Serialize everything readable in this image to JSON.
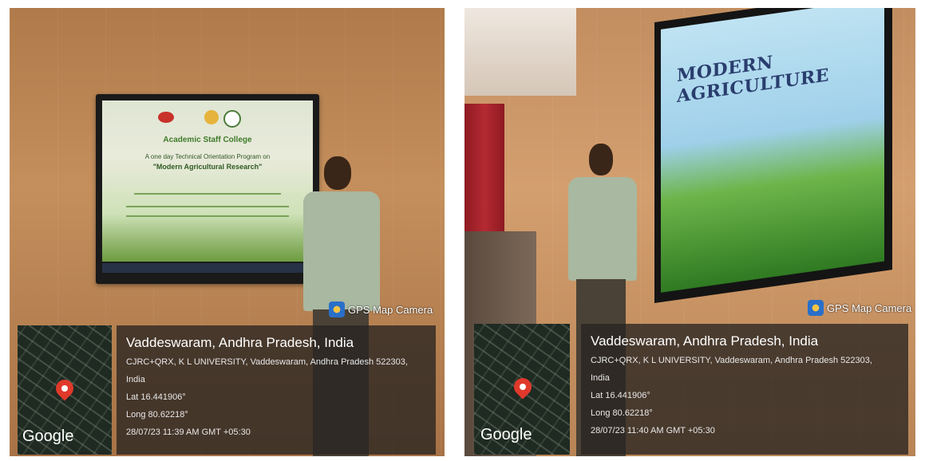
{
  "photo1": {
    "slide": {
      "line1": "Academic Staff College",
      "line2": "A one day Technical Orientation Program on",
      "line3": "\"Modern Agricultural Research\""
    },
    "gps_tag": "GPS Map Camera",
    "map_label": "Google",
    "location_title": "Vaddeswaram, Andhra Pradesh, India",
    "address_line1": "CJRC+QRX, K L UNIVERSITY, Vaddeswaram, Andhra Pradesh 522303,",
    "address_line2": "India",
    "lat": "Lat 16.441906°",
    "long": "Long 80.62218°",
    "timestamp": "28/07/23 11:39 AM GMT +05:30"
  },
  "photo2": {
    "slide_title": "MODERN AGRICULTURE",
    "gps_tag": "GPS Map Camera",
    "map_label": "Google",
    "location_title": "Vaddeswaram, Andhra Pradesh, India",
    "address_line1": "CJRC+QRX, K L UNIVERSITY, Vaddeswaram, Andhra Pradesh 522303,",
    "address_line2": "India",
    "lat": "Lat 16.441906°",
    "long": "Long 80.62218°",
    "timestamp": "28/07/23 11:40 AM GMT +05:30"
  },
  "colors": {
    "overlay_panel": "#28241f",
    "pin": "#e0392b",
    "slide_title": "#2a3e6e"
  }
}
